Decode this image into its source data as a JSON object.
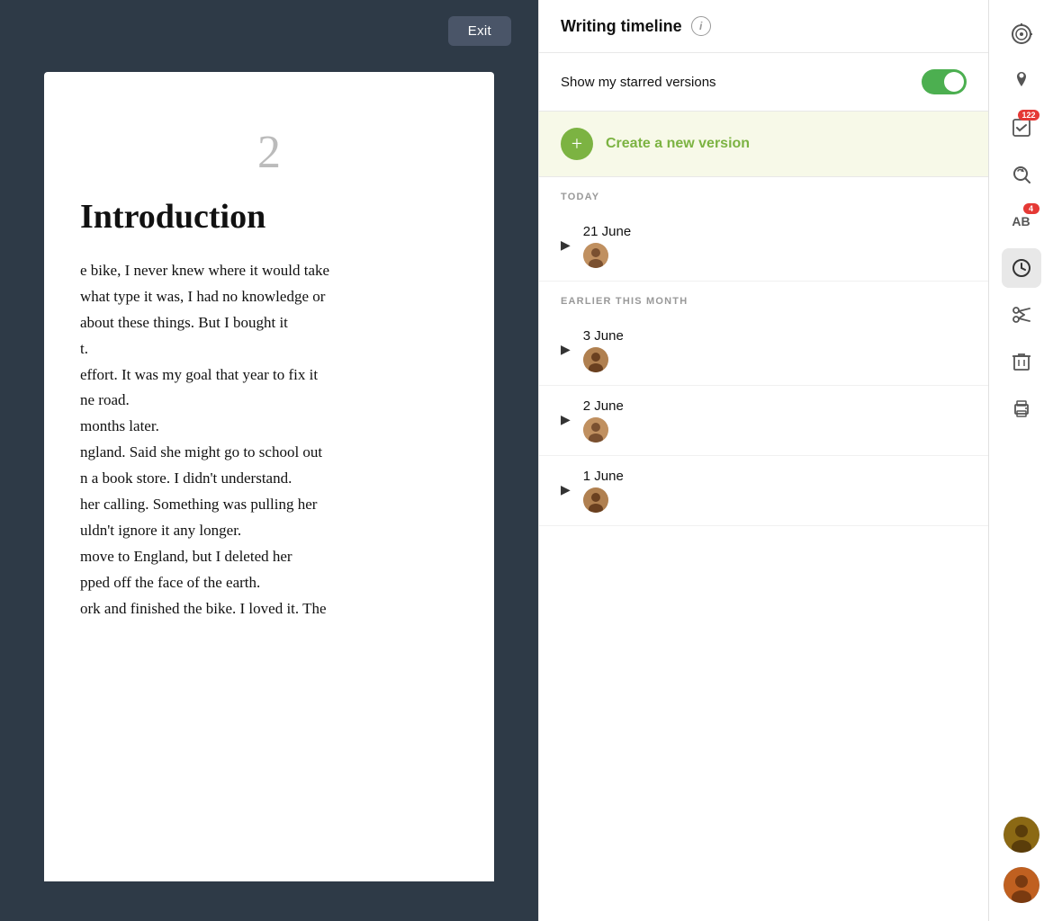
{
  "exit_button": "Exit",
  "doc": {
    "page_number": "2",
    "title": "Introduction",
    "body": "e bike, I never knew where it would take\nwhat type it was, I had no knowledge or\nabout these things. But I bought it\nt.\neffort. It was my goal that year to fix it\nne road.\nmonths later.\nngland. Said she might go to school out\nn a book store. I didn't understand.\nher calling. Something was pulling her\nuldn't ignore it any longer.\nmove to England, but I deleted her\npped off the face of the earth.\nork and finished the bike. I loved it. The"
  },
  "timeline": {
    "title": "Writing timeline",
    "toggle_label": "Show my starred versions",
    "toggle_on": true,
    "create_label": "Create a new version",
    "sections": [
      {
        "header": "TODAY",
        "entries": [
          {
            "date": "21 June"
          }
        ]
      },
      {
        "header": "EARLIER THIS MONTH",
        "entries": [
          {
            "date": "3 June"
          },
          {
            "date": "2 June"
          },
          {
            "date": "1 June"
          }
        ]
      }
    ]
  },
  "sidebar": {
    "icons": [
      {
        "name": "target-icon",
        "symbol": "◎",
        "badge": null
      },
      {
        "name": "pin-icon",
        "symbol": "📌",
        "badge": null
      },
      {
        "name": "checklist-icon",
        "symbol": "☑",
        "badge": "122"
      },
      {
        "name": "search-icon",
        "symbol": "⟳",
        "badge": null
      },
      {
        "name": "spellcheck-icon",
        "symbol": "AB",
        "badge": "4"
      },
      {
        "name": "clock-icon",
        "symbol": "⏱",
        "badge": null
      },
      {
        "name": "scissors-icon",
        "symbol": "✂",
        "badge": null
      },
      {
        "name": "trash-icon",
        "symbol": "🗑",
        "badge": null
      },
      {
        "name": "print-icon",
        "symbol": "🖨",
        "badge": null
      }
    ],
    "users": [
      {
        "name": "user-1",
        "color": "#8B6914"
      },
      {
        "name": "user-2",
        "color": "#c06020"
      }
    ]
  }
}
